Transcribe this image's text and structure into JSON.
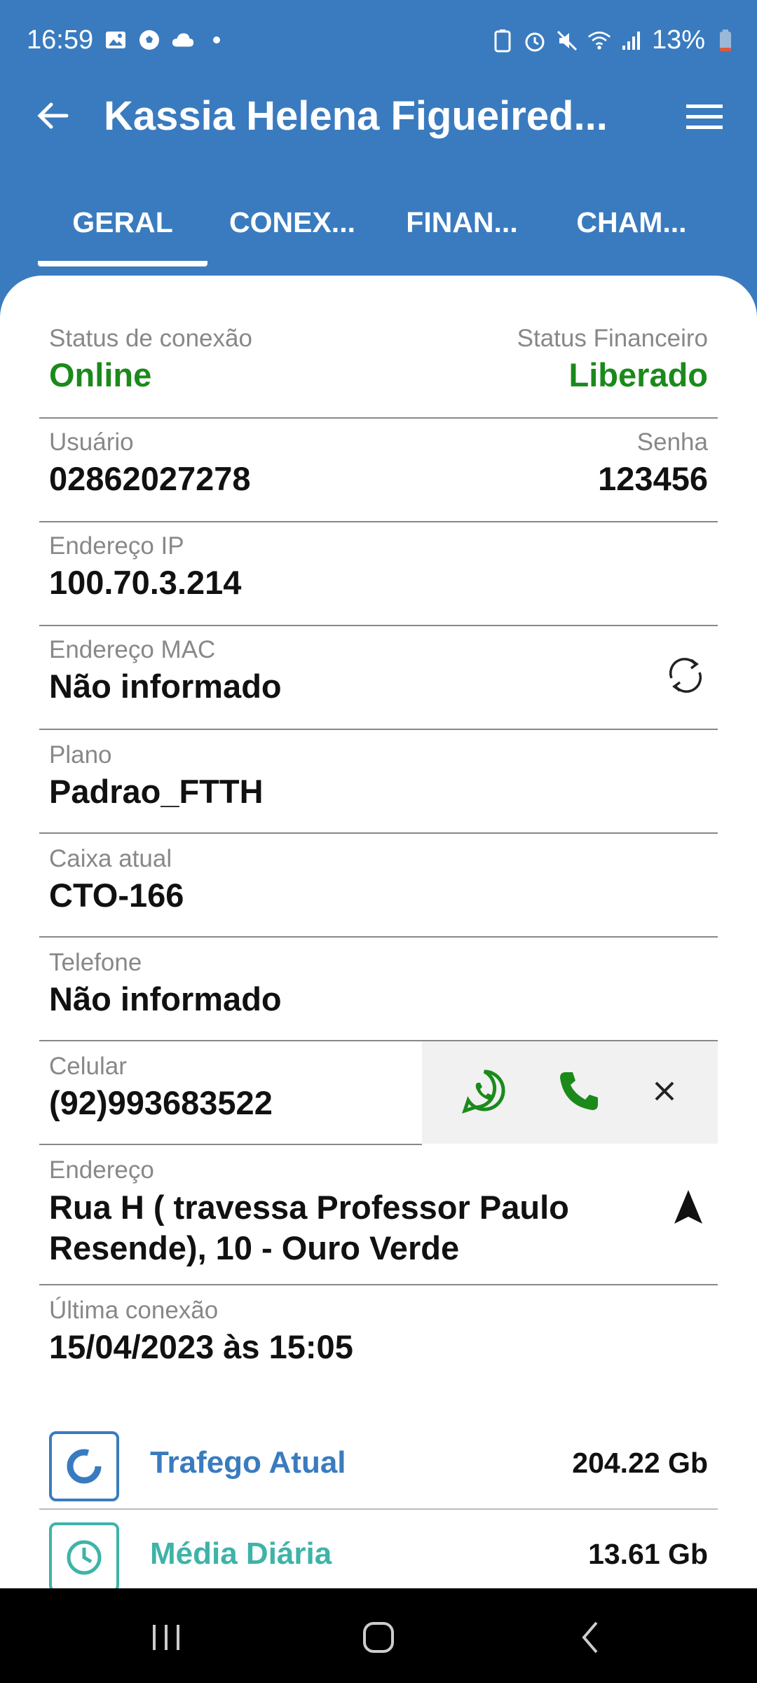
{
  "statusbar": {
    "time": "16:59",
    "battery": "13%"
  },
  "appbar": {
    "title": "Kassia Helena Figueired..."
  },
  "tabs": [
    {
      "label": "GERAL",
      "active": true
    },
    {
      "label": "CONEX..."
    },
    {
      "label": "FINAN..."
    },
    {
      "label": "CHAM..."
    }
  ],
  "fields": {
    "status_conexao": {
      "label": "Status de conexão",
      "value": "Online"
    },
    "status_financeiro": {
      "label": "Status Financeiro",
      "value": "Liberado"
    },
    "usuario": {
      "label": "Usuário",
      "value": "02862027278"
    },
    "senha": {
      "label": "Senha",
      "value": "123456"
    },
    "ip": {
      "label": "Endereço IP",
      "value": "100.70.3.214"
    },
    "mac": {
      "label": "Endereço MAC",
      "value": "Não informado"
    },
    "plano": {
      "label": "Plano",
      "value": "Padrao_FTTH"
    },
    "caixa": {
      "label": "Caixa atual",
      "value": "CTO-166"
    },
    "telefone": {
      "label": "Telefone",
      "value": "Não informado"
    },
    "celular": {
      "label": "Celular",
      "value": "(92)993683522"
    },
    "endereco": {
      "label": "Endereço",
      "value": "Rua H ( travessa Professor Paulo Resende), 10 - Ouro Verde"
    },
    "ultima_conexao": {
      "label": "Última conexão",
      "value": "15/04/2023 às 15:05"
    }
  },
  "metrics": [
    {
      "label": "Trafego Atual",
      "value": "204.22 Gb",
      "color": "#3a7bbf",
      "icon": "donut-chart-icon"
    },
    {
      "label": "Média Diária",
      "value": "13.61 Gb",
      "color": "#3fb3a8",
      "icon": "clock-icon"
    }
  ],
  "colors": {
    "primary": "#3a7bbf",
    "online": "#1b8a1b",
    "whatsapp": "#1b8a1b",
    "teal": "#3fb3a8"
  }
}
